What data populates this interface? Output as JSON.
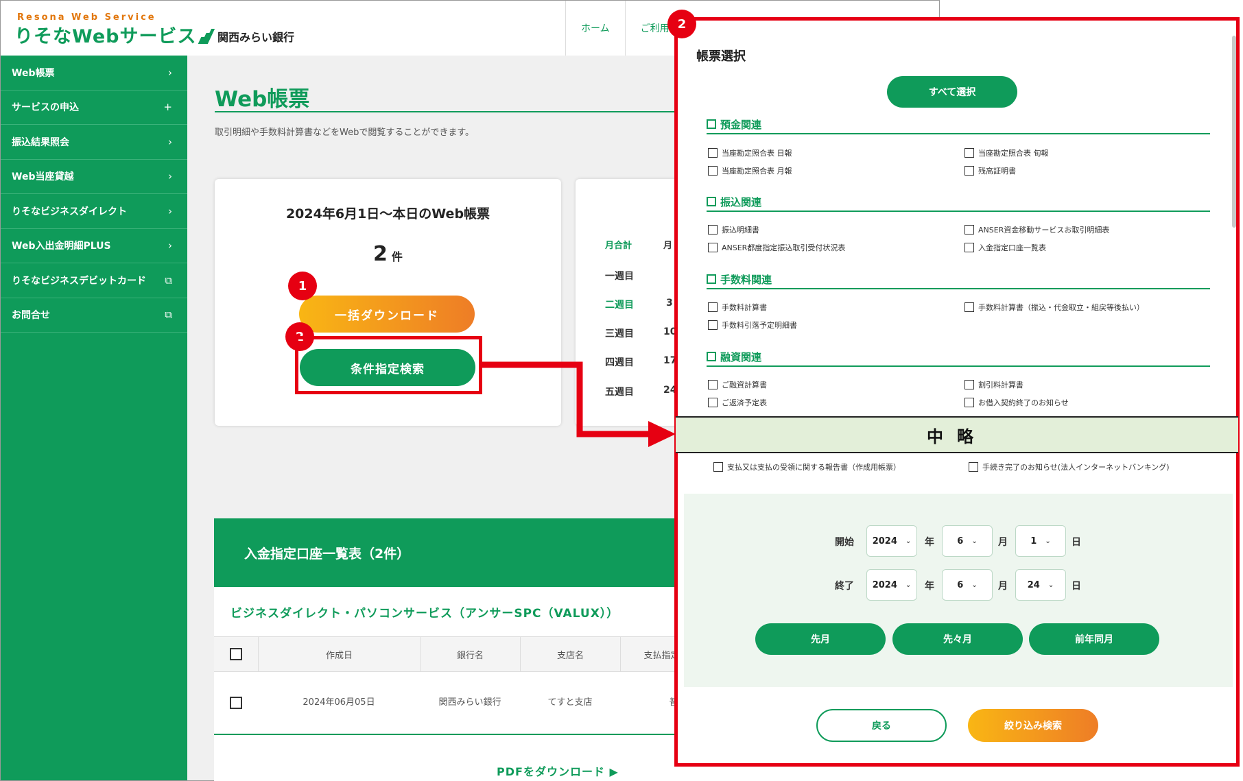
{
  "header": {
    "brand_en": "Resona Web Service",
    "brand_jp": "りそなWebサービス",
    "kansai_bank": "関西みらい銀行",
    "nav": [
      "ホーム",
      "ご利用"
    ]
  },
  "sidebar": {
    "items": [
      {
        "label": "Web帳票",
        "icon": "chevron-right-icon",
        "glyph": "›"
      },
      {
        "label": "サービスの申込",
        "icon": "plus-icon",
        "glyph": "+"
      },
      {
        "label": "振込結果照会",
        "icon": "chevron-right-icon",
        "glyph": "›"
      },
      {
        "label": "Web当座貸越",
        "icon": "chevron-right-icon",
        "glyph": "›"
      },
      {
        "label": "りそなビジネスダイレクト",
        "icon": "chevron-right-icon",
        "glyph": "›"
      },
      {
        "label": "Web入出金明細PLUS",
        "icon": "chevron-right-icon",
        "glyph": "›"
      },
      {
        "label": "りそなビジネスデビットカード",
        "icon": "external-window-icon",
        "glyph": "⧉"
      },
      {
        "label": "お問合せ",
        "icon": "external-window-icon",
        "glyph": "⧉"
      }
    ]
  },
  "main": {
    "title": "Web帳票",
    "description": "取引明細や手数料計算書などをWebで閲覧することができます。",
    "card": {
      "title": "2024年6月1日〜本日のWeb帳票",
      "count": "2",
      "count_unit": "件",
      "bulk_download": "一括ダウンロード",
      "condition_search": "条件指定検索"
    },
    "weekly": {
      "header": "月合計",
      "header2": "月",
      "rows": [
        {
          "label": "一週目",
          "value": ""
        },
        {
          "label": "二週目",
          "value": "3"
        },
        {
          "label": "三週目",
          "value": "10"
        },
        {
          "label": "四週目",
          "value": "17"
        },
        {
          "label": "五週目",
          "value": "24"
        }
      ]
    },
    "table_card": {
      "header": "入金指定口座一覧表（2件）",
      "subtitle": "ビジネスダイレクト・パソコンサービス（アンサーSPC（VALUX））",
      "columns": [
        "作成日",
        "銀行名",
        "支店名",
        "支払指定"
      ],
      "row": {
        "date": "2024年06月05日",
        "bank": "関西みらい銀行",
        "branch": "てすと支店",
        "extra": "普"
      },
      "pdf_download": "PDFをダウンロード"
    }
  },
  "annotations": {
    "badge_1": "1",
    "badge_2": "2",
    "badge_modal": "2",
    "accent_color": "#e60012"
  },
  "modal": {
    "title": "帳票選択",
    "select_all": "すべて選択",
    "sections": [
      {
        "title": "預金関連",
        "options": [
          "当座勘定照合表 日報",
          "当座勘定照合表 旬報",
          "当座勘定照合表 月報",
          "残高証明書"
        ]
      },
      {
        "title": "振込関連",
        "options": [
          "振込明細書",
          "ANSER資金移動サービスお取引明細表",
          "ANSER都度指定振込取引受付状況表",
          "入金指定口座一覧表"
        ]
      },
      {
        "title": "手数料関連",
        "options": [
          "手数料計算書",
          "手数料計算書（振込・代金取立・組戻等後払い）",
          "手数料引落予定明細書"
        ]
      },
      {
        "title": "融資関連",
        "options": [
          "ご融資計算書",
          "割引料計算書",
          "ご返済予定表",
          "お借入契約終了のお知らせ"
        ]
      }
    ],
    "omitted": "中略",
    "after_omitted": [
      "支払又は支払の受領に関する報告書（作成用帳票）",
      "手続き完了のお知らせ(法人インターネットバンキング)"
    ],
    "date": {
      "start_label": "開始",
      "end_label": "終了",
      "year_unit": "年",
      "month_unit": "月",
      "day_unit": "日",
      "start": {
        "year": "2024",
        "month": "6",
        "day": "1"
      },
      "end": {
        "year": "2024",
        "month": "6",
        "day": "24"
      },
      "presets": [
        "先月",
        "先々月",
        "前年同月"
      ]
    },
    "back": "戻る",
    "filter_search": "絞り込み検索"
  }
}
